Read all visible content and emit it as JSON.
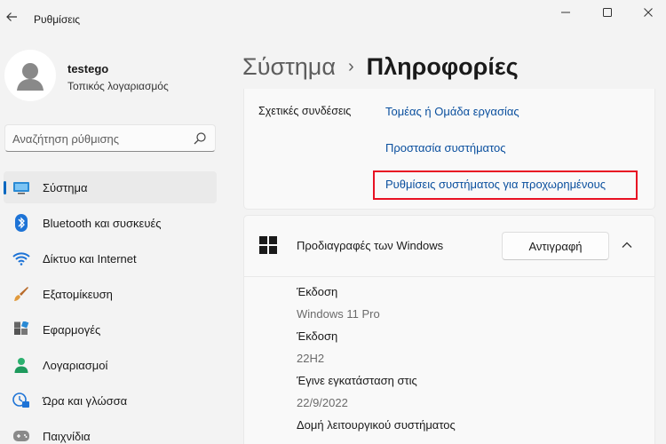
{
  "window": {
    "title": "Ρυθμίσεις"
  },
  "profile": {
    "name": "testego",
    "account_type": "Τοπικός λογαριασμός"
  },
  "search": {
    "placeholder": "Αναζήτηση ρύθμισης"
  },
  "sidebar": {
    "items": [
      {
        "label": "Σύστημα",
        "icon": "system-icon",
        "active": true
      },
      {
        "label": "Bluetooth και συσκευές",
        "icon": "bluetooth-icon"
      },
      {
        "label": "Δίκτυο και Internet",
        "icon": "wifi-icon"
      },
      {
        "label": "Εξατομίκευση",
        "icon": "brush-icon"
      },
      {
        "label": "Εφαρμογές",
        "icon": "apps-icon"
      },
      {
        "label": "Λογαριασμοί",
        "icon": "accounts-icon"
      },
      {
        "label": "Ώρα και γλώσσα",
        "icon": "time-language-icon"
      },
      {
        "label": "Παιχνίδια",
        "icon": "gaming-icon"
      }
    ]
  },
  "breadcrumb": {
    "parent": "Σύστημα",
    "separator": "›",
    "current": "Πληροφορίες"
  },
  "related": {
    "label": "Σχετικές συνδέσεις",
    "links": [
      "Τομέας ή Ομάδα εργασίας",
      "Προστασία συστήματος",
      "Ρυθμίσεις συστήματος για προχωρημένους"
    ]
  },
  "windows_specs": {
    "title": "Προδιαγραφές των Windows",
    "copy_label": "Αντιγραφή",
    "rows": [
      {
        "label": "Έκδοση",
        "value": "Windows 11 Pro"
      },
      {
        "label": "Έκδοση",
        "value": "22H2"
      },
      {
        "label": "Έγινε εγκατάσταση στις",
        "value": "22/9/2022"
      },
      {
        "label": "Δομή λειτουργικού συστήματος",
        "value": ""
      }
    ]
  },
  "colors": {
    "accent": "#0067c0",
    "link": "#0a4f9e",
    "highlight": "#e81123"
  }
}
